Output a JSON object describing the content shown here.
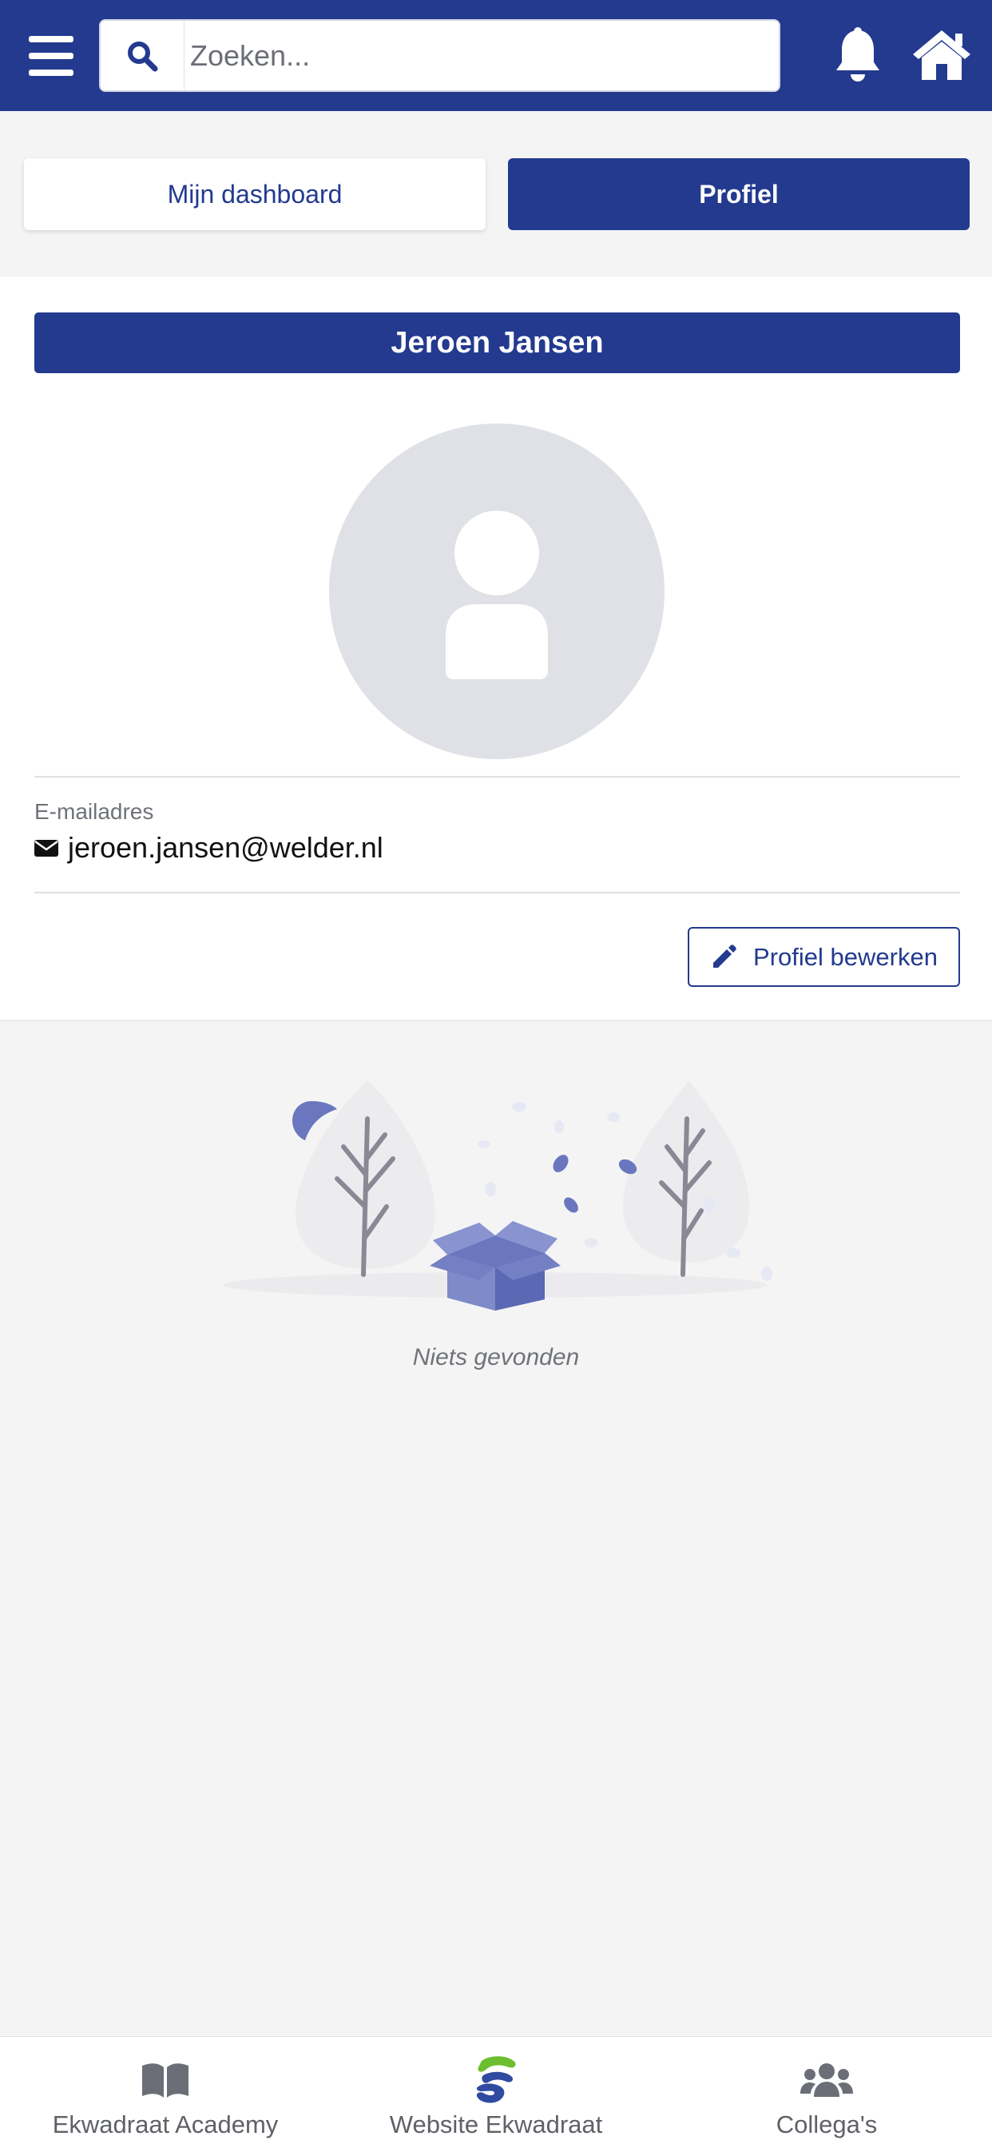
{
  "header": {
    "search_placeholder": "Zoeken...",
    "brand_color": "#233a8f"
  },
  "tabs": [
    {
      "label": "Mijn dashboard",
      "active": false
    },
    {
      "label": "Profiel",
      "active": true
    }
  ],
  "profile": {
    "name": "Jeroen Jansen",
    "email_label": "E-mailadres",
    "email": "jeroen.jansen@welder.nl",
    "edit_label": "Profiel bewerken"
  },
  "empty_state": {
    "text": "Niets gevonden"
  },
  "bottom_nav": [
    {
      "label": "Ekwadraat Academy",
      "icon": "book-icon"
    },
    {
      "label": "Website Ekwadraat",
      "icon": "ekwadraat-logo-icon"
    },
    {
      "label": "Collega's",
      "icon": "users-icon"
    }
  ]
}
